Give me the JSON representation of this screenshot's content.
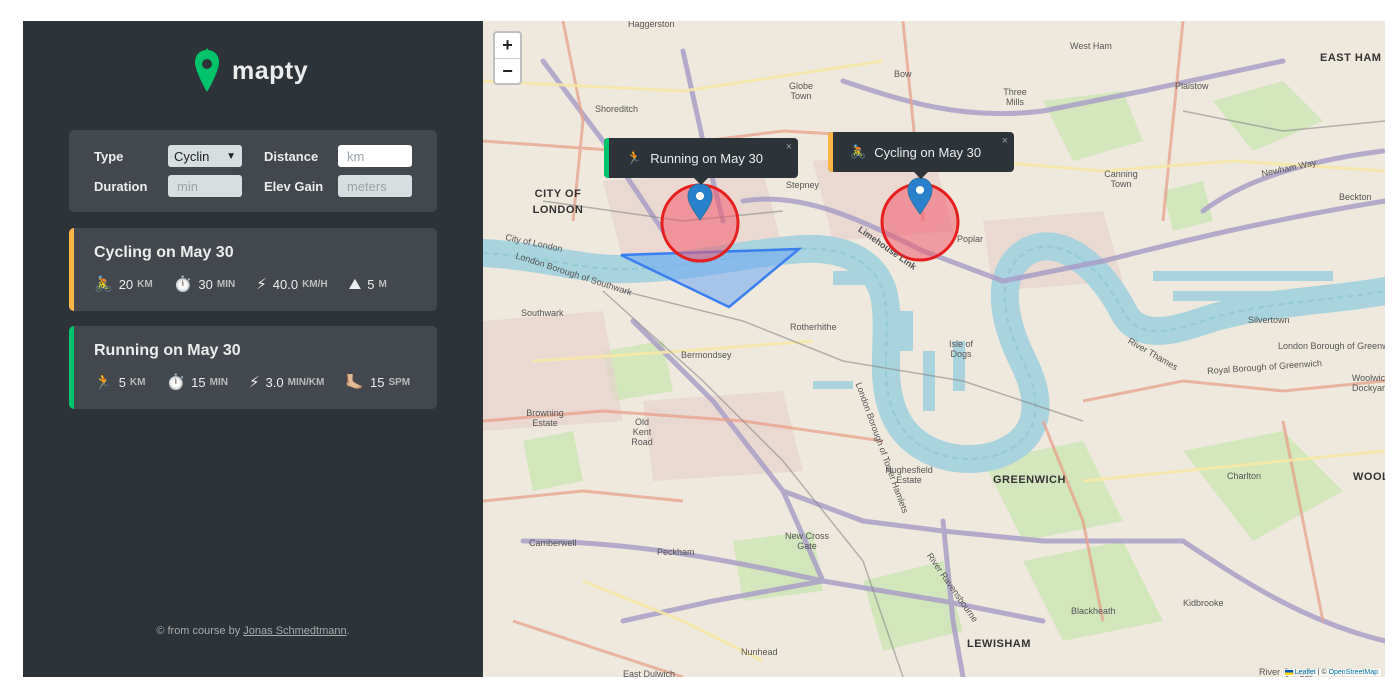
{
  "app": {
    "logo_text": "mapty",
    "brand_color": "#00c46a",
    "cycling_color": "#ffb545",
    "running_color": "#00c46a"
  },
  "form": {
    "type_label": "Type",
    "type_value": "Cyclin",
    "distance_label": "Distance",
    "distance_placeholder": "km",
    "duration_label": "Duration",
    "duration_placeholder": "min",
    "elev_label": "Elev Gain",
    "elev_placeholder": "meters"
  },
  "workouts": [
    {
      "title": "Cycling on May 30",
      "type": "cycling",
      "details": [
        {
          "icon": "🚴",
          "value": "20",
          "unit": "km"
        },
        {
          "icon": "⏱️",
          "value": "30",
          "unit": "min"
        },
        {
          "icon": "⚡",
          "value": "40.0",
          "unit": "km/h"
        },
        {
          "icon": "⛰",
          "value": "5",
          "unit": "m"
        }
      ]
    },
    {
      "title": "Running on May 30",
      "type": "running",
      "details": [
        {
          "icon": "🏃",
          "value": "5",
          "unit": "km"
        },
        {
          "icon": "⏱️",
          "value": "15",
          "unit": "min"
        },
        {
          "icon": "⚡",
          "value": "3.0",
          "unit": "min/km"
        },
        {
          "icon": "🦶🏼",
          "value": "15",
          "unit": "spm"
        }
      ]
    }
  ],
  "copyright": {
    "prefix": "© from course by ",
    "author": "Jonas Schmedtmann",
    "suffix": "."
  },
  "map": {
    "zoom_in": "+",
    "zoom_out": "−",
    "popups": [
      {
        "icon": "🏃",
        "text": "Running on May 30",
        "close": "×"
      },
      {
        "icon": "🚴",
        "text": "Cycling on May 30",
        "close": "×"
      }
    ],
    "attribution_leaflet": "Leaflet",
    "attribution_sep": " | © ",
    "attribution_osm": "OpenStreetMap",
    "labels": {
      "haggerston": "Haggerston",
      "west_ham": "West Ham",
      "east_ham": "EAST HAM",
      "bow": "Bow",
      "globe_town": "Globe Town",
      "three_mills": "Three Mills",
      "plaistow": "Plaistow",
      "shoreditch": "Shoreditch",
      "city_of_london": "CITY OF LONDON",
      "stepney": "Stepney",
      "canning_town": "Canning Town",
      "newham_way": "Newham Way",
      "beckton": "Beckton",
      "city_of_london_road": "City of London",
      "london_borough_southwark": "London Borough of Southwark",
      "limehouse_link": "Limehouse Link",
      "poplar": "Poplar",
      "southwark": "Southwark",
      "rotherhithe": "Rotherhithe",
      "silvertown": "Silvertown",
      "isle_of_dogs": "Isle of Dogs",
      "lb_greenwich": "London Borough of Greenwich",
      "royal_borough_greenwich": "Royal Borough of Greenwich",
      "woolwich_dockyard": "Woolwich Dockyard",
      "bermondsey": "Bermondsey",
      "river_thames": "River Thames",
      "tower_hamlets": "London Borough of Tower Hamlets",
      "browning_estate": "Browning Estate",
      "old_kent_road": "Old Kent Road",
      "hughesfield": "Hughesfield Estate",
      "greenwich": "GREENWICH",
      "charlton": "Charlton",
      "woolwich": "WOOL",
      "camberwell": "Camberwell",
      "peckham": "Peckham",
      "new_cross_gate": "New Cross Gate",
      "river_ravensbourne": "River Ravensbourne",
      "blackheath": "Blackheath",
      "kidbrooke": "Kidbrooke",
      "nunhead": "Nunhead",
      "lewisham": "LEWISHAM",
      "east_dulwich": "East Dulwich",
      "river_quaggy": "River Quaggy"
    }
  }
}
